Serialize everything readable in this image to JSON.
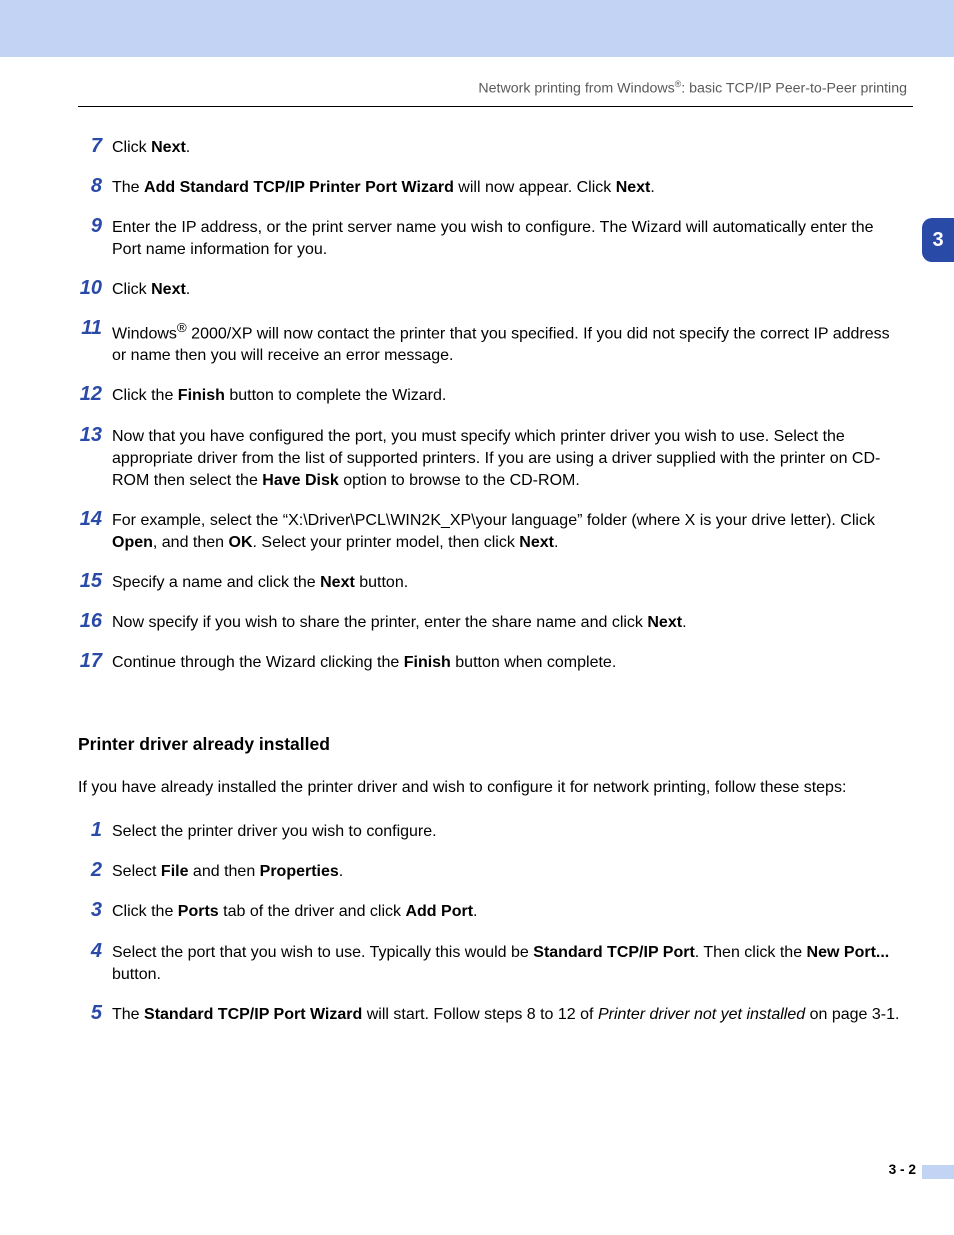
{
  "header": {
    "pre": "Network printing from Windows",
    "sup": "®",
    "post": ": basic TCP/IP Peer-to-Peer printing"
  },
  "chapter_tab": "3",
  "steps_a": [
    {
      "n": "7",
      "html": "Click <b>Next</b>."
    },
    {
      "n": "8",
      "html": "The <b>Add Standard TCP/IP Printer Port Wizard</b> will now appear. Click <b>Next</b>."
    },
    {
      "n": "9",
      "html": "Enter the IP address, or the print server name you wish to configure. The Wizard will automatically enter the Port name information for you."
    },
    {
      "n": "10",
      "html": "Click <b>Next</b>."
    },
    {
      "n": "11",
      "html": "Windows<sup>®</sup> 2000/XP will now contact the printer that you specified. If you did not specify the correct IP address or name then you will receive an error message."
    },
    {
      "n": "12",
      "html": "Click the <b>Finish</b> button to complete the Wizard."
    },
    {
      "n": "13",
      "html": "Now that you have configured the port, you must specify which printer driver you wish to use. Select the appropriate driver from the list of supported printers. If you are using a driver supplied with the printer on CD-ROM then select the <b>Have Disk</b> option to browse to the CD-ROM."
    },
    {
      "n": "14",
      "html": "For example, select the “X:\\Driver\\PCL\\WIN2K_XP\\your language” folder (where X is your drive letter). Click <b>Open</b>, and then <b>OK</b>. Select your printer model, then click <b>Next</b>."
    },
    {
      "n": "15",
      "html": "Specify a name and click the <b>Next</b> button."
    },
    {
      "n": "16",
      "html": "Now specify if you wish to share the printer, enter the share name and click <b>Next</b>."
    },
    {
      "n": "17",
      "html": "Continue through the Wizard clicking the <b>Finish</b> button when complete."
    }
  ],
  "section_b": {
    "heading": "Printer driver already installed",
    "intro": "If you have already installed the printer driver and wish to configure it for network printing, follow these steps:",
    "steps": [
      {
        "n": "1",
        "html": "Select the printer driver you wish to configure."
      },
      {
        "n": "2",
        "html": "Select <b>File</b> and then <b>Properties</b>."
      },
      {
        "n": "3",
        "html": "Click the <b>Ports</b> tab of the driver and click <b>Add Port</b>."
      },
      {
        "n": "4",
        "html": "Select the port that you wish to use. Typically this would be <b>Standard TCP/IP Port</b>. Then click the <b>New Port...</b> button."
      },
      {
        "n": "5",
        "html": "The <b>Standard TCP/IP Port Wizard</b> will start. Follow steps 8 to 12 of <i>Printer driver not yet installed</i> on page 3-1."
      }
    ]
  },
  "footer": "3 - 2"
}
